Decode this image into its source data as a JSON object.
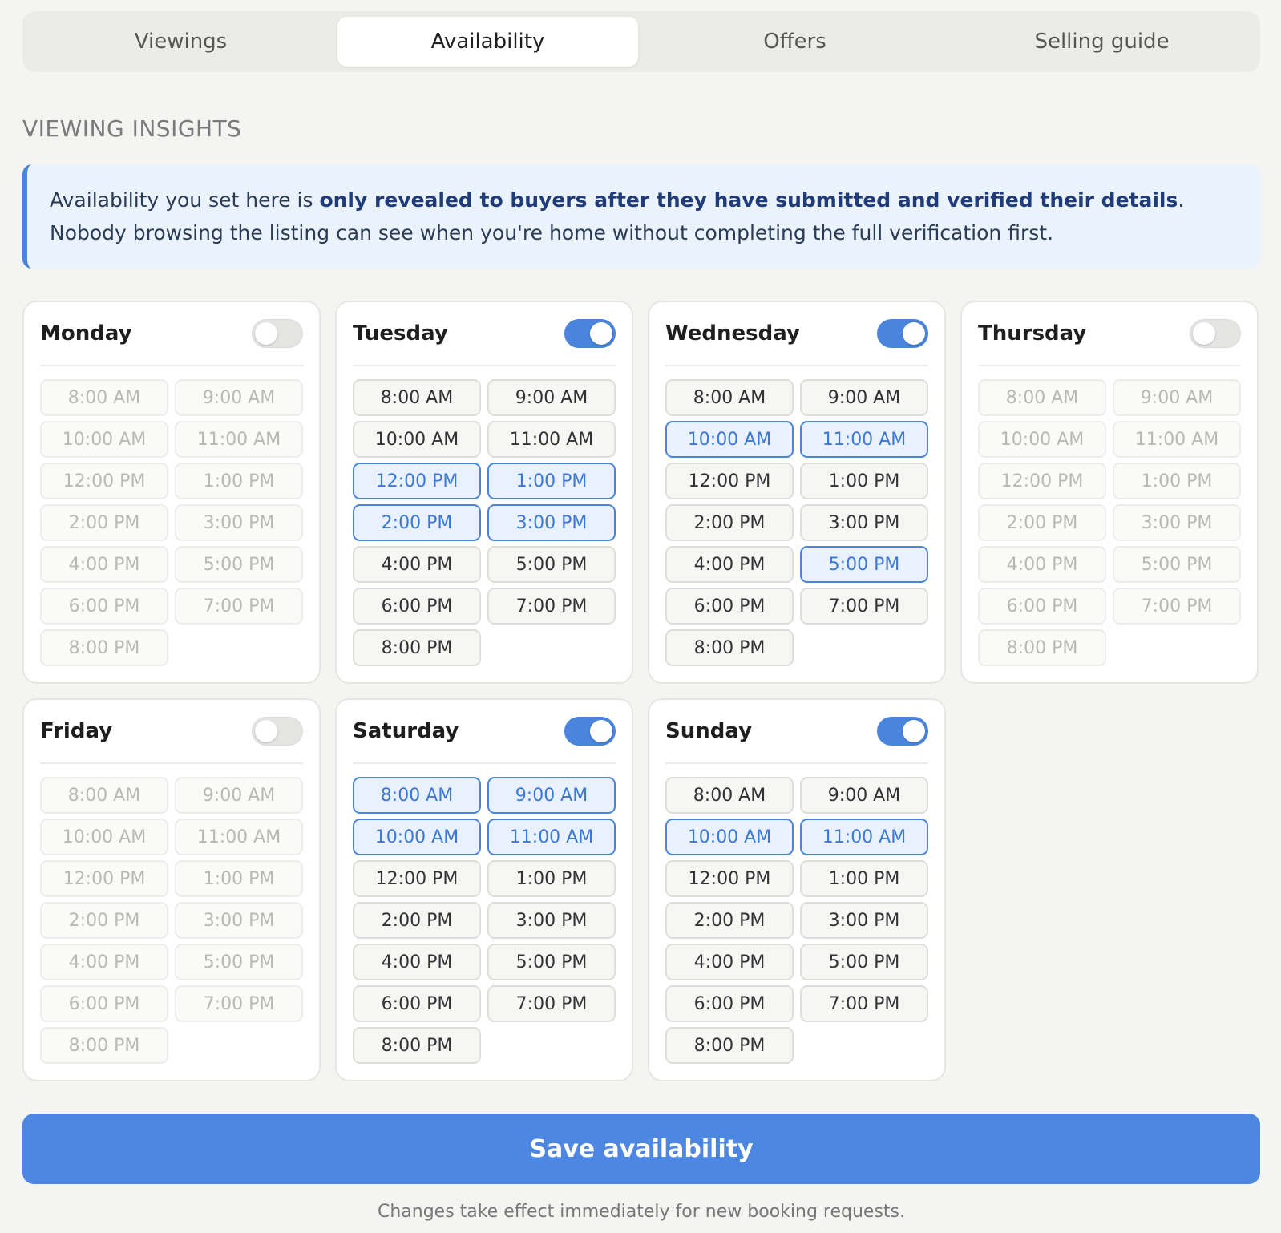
{
  "tabs": [
    {
      "label": "Viewings",
      "active": false
    },
    {
      "label": "Availability",
      "active": true
    },
    {
      "label": "Offers",
      "active": false
    },
    {
      "label": "Selling guide",
      "active": false
    }
  ],
  "section_title": "VIEWING INSIGHTS",
  "notice": {
    "prefix": "Availability you set here is ",
    "bold": "only revealed to buyers after they have submitted and verified their details",
    "suffix": ". Nobody browsing the listing can see when you're home without completing the full verification first."
  },
  "accent_color": "#4a84dc",
  "slot_labels": [
    "8:00 AM",
    "9:00 AM",
    "10:00 AM",
    "11:00 AM",
    "12:00 PM",
    "1:00 PM",
    "2:00 PM",
    "3:00 PM",
    "4:00 PM",
    "5:00 PM",
    "6:00 PM",
    "7:00 PM",
    "8:00 PM"
  ],
  "days": [
    {
      "name": "Monday",
      "enabled": false,
      "selected": []
    },
    {
      "name": "Tuesday",
      "enabled": true,
      "selected": [
        4,
        5,
        6,
        7
      ]
    },
    {
      "name": "Wednesday",
      "enabled": true,
      "selected": [
        2,
        3,
        9
      ]
    },
    {
      "name": "Thursday",
      "enabled": false,
      "selected": []
    },
    {
      "name": "Friday",
      "enabled": false,
      "selected": []
    },
    {
      "name": "Saturday",
      "enabled": true,
      "selected": [
        0,
        1,
        2,
        3
      ]
    },
    {
      "name": "Sunday",
      "enabled": true,
      "selected": [
        2,
        3
      ]
    }
  ],
  "save_label": "Save availability",
  "footer_note": "Changes take effect immediately for new booking requests."
}
